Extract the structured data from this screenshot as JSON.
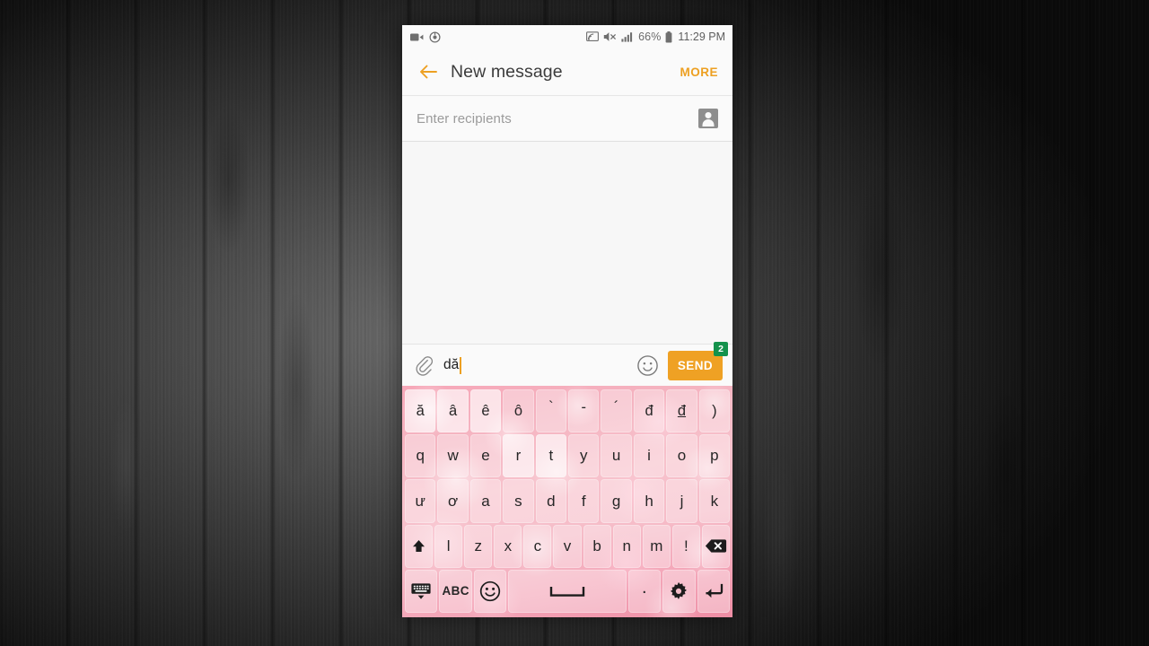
{
  "wallpaper": {
    "description": "dark-wood-plank-texture"
  },
  "statusbar": {
    "left_icons": [
      "video-camera-icon",
      "alarm-icon"
    ],
    "right_icons": [
      "screen-cast-icon",
      "mute-icon",
      "signal-bars-icon"
    ],
    "battery_percent": "66%",
    "battery_icon": "battery-icon",
    "time": "11:29 PM"
  },
  "appbar": {
    "back_icon": "back-arrow-icon",
    "title": "New message",
    "more_label": "MORE",
    "accent_color": "#eda022"
  },
  "recipients": {
    "placeholder": "Enter recipients",
    "contact_icon": "contact-picker-icon"
  },
  "compose": {
    "attach_icon": "paperclip-icon",
    "text": "dă",
    "emoji_icon": "emoji-smiley-icon",
    "send_label": "SEND",
    "send_badge": "2",
    "send_color": "#efa124",
    "badge_color": "#14924c"
  },
  "keyboard": {
    "theme": "pink-bokeh-floral",
    "rows": [
      {
        "name": "diacritics-row",
        "keys": [
          {
            "label": "ă",
            "name": "key-a-breve"
          },
          {
            "label": "â",
            "name": "key-a-circumflex"
          },
          {
            "label": "ê",
            "name": "key-e-circumflex"
          },
          {
            "label": "ô",
            "name": "key-o-circumflex"
          },
          {
            "label": "`",
            "name": "key-grave-accent"
          },
          {
            "label": "-",
            "name": "key-macron-accent"
          },
          {
            "label": "´",
            "name": "key-acute-accent"
          },
          {
            "label": "đ",
            "name": "key-d-stroke"
          },
          {
            "label": "đ",
            "name": "key-d-stroke-underlined"
          },
          {
            "label": ")",
            "name": "key-close-paren"
          }
        ]
      },
      {
        "name": "qwerty-row",
        "keys": [
          {
            "label": "q",
            "name": "key-q"
          },
          {
            "label": "w",
            "name": "key-w"
          },
          {
            "label": "e",
            "name": "key-e"
          },
          {
            "label": "r",
            "name": "key-r"
          },
          {
            "label": "t",
            "name": "key-t"
          },
          {
            "label": "y",
            "name": "key-y"
          },
          {
            "label": "u",
            "name": "key-u"
          },
          {
            "label": "i",
            "name": "key-i"
          },
          {
            "label": "o",
            "name": "key-o"
          },
          {
            "label": "p",
            "name": "key-p"
          }
        ]
      },
      {
        "name": "home-row",
        "keys": [
          {
            "label": "ư",
            "name": "key-u-horn"
          },
          {
            "label": "ơ",
            "name": "key-o-horn"
          },
          {
            "label": "a",
            "name": "key-a"
          },
          {
            "label": "s",
            "name": "key-s"
          },
          {
            "label": "d",
            "name": "key-d"
          },
          {
            "label": "f",
            "name": "key-f"
          },
          {
            "label": "g",
            "name": "key-g"
          },
          {
            "label": "h",
            "name": "key-h"
          },
          {
            "label": "j",
            "name": "key-j"
          },
          {
            "label": "k",
            "name": "key-k"
          }
        ]
      },
      {
        "name": "bottom-letter-row",
        "keys": [
          {
            "label": "",
            "name": "key-shift"
          },
          {
            "label": "l",
            "name": "key-l"
          },
          {
            "label": "z",
            "name": "key-z"
          },
          {
            "label": "x",
            "name": "key-x"
          },
          {
            "label": "c",
            "name": "key-c"
          },
          {
            "label": "v",
            "name": "key-v"
          },
          {
            "label": "b",
            "name": "key-b"
          },
          {
            "label": "n",
            "name": "key-n"
          },
          {
            "label": "m",
            "name": "key-m"
          },
          {
            "label": "!",
            "name": "key-exclamation"
          },
          {
            "label": "",
            "name": "key-backspace"
          }
        ]
      },
      {
        "name": "function-row",
        "keys": [
          {
            "label": "",
            "name": "key-hide-keyboard"
          },
          {
            "label": "ABC",
            "name": "key-abc-layout"
          },
          {
            "label": "",
            "name": "key-emoji"
          },
          {
            "label": "",
            "name": "key-space"
          },
          {
            "label": ".",
            "name": "key-period"
          },
          {
            "label": "",
            "name": "key-settings"
          },
          {
            "label": "",
            "name": "key-enter"
          }
        ]
      }
    ]
  }
}
